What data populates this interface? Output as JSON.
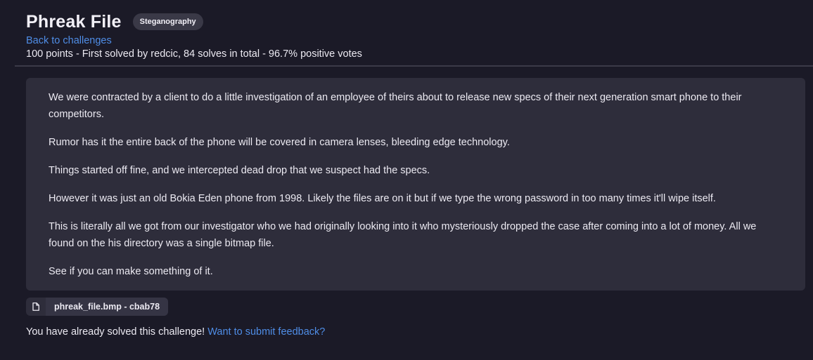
{
  "challenge": {
    "title": "Phreak File",
    "category": "Steganography",
    "back_link": "Back to challenges",
    "meta": "100 points - First solved by redcic, 84 solves in total - 96.7% positive votes"
  },
  "description": {
    "paragraphs": [
      "We were contracted by a client to do a little investigation of an employee of theirs about to release new specs of their next generation smart phone to their competitors.",
      "Rumor has it the entire back of the phone will be covered in camera lenses, bleeding edge technology.",
      "Things started off fine, and we intercepted dead drop that we suspect had the specs.",
      "However it was just an old Bokia Eden phone from 1998. Likely the files are on it but if we type the wrong password in too many times it'll wipe itself.",
      "This is literally all we got from our investigator who we had originally looking into it who mysteriously dropped the case after coming into a lot of money. All we found on the his directory was a single bitmap file.",
      "See if you can make something of it."
    ]
  },
  "attachment": {
    "icon": "file-icon",
    "label": "phreak_file.bmp - cbab78"
  },
  "status": {
    "text": "You have already solved this challenge! ",
    "feedback_link": "Want to submit feedback?"
  },
  "colors": {
    "background": "#1b1a27",
    "card": "#2e2d3b",
    "link": "#4f8de6",
    "tag": "#3a3947"
  }
}
